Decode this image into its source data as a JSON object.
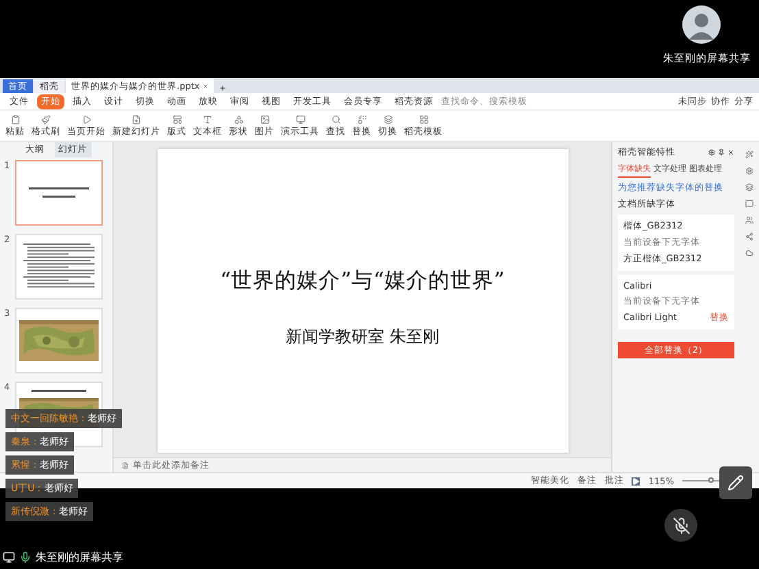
{
  "share_header": {
    "presenter": "朱至刚的屏幕共享"
  },
  "app": {
    "tabs": [
      {
        "label": "首页",
        "selected": false
      },
      {
        "label": "稻壳",
        "selected": false
      },
      {
        "label": "世界的媒介与媒介的世界.pptx",
        "selected": true
      }
    ],
    "menu": [
      {
        "label": "文件",
        "selected": false
      },
      {
        "label": "开始",
        "selected": true
      },
      {
        "label": "插入",
        "selected": false
      },
      {
        "label": "设计",
        "selected": false
      },
      {
        "label": "切换",
        "selected": false
      },
      {
        "label": "动画",
        "selected": false
      },
      {
        "label": "放映",
        "selected": false
      },
      {
        "label": "审阅",
        "selected": false
      },
      {
        "label": "视图",
        "selected": false
      },
      {
        "label": "开发工具",
        "selected": false
      },
      {
        "label": "会员专享",
        "selected": false
      },
      {
        "label": "稻壳资源",
        "selected": false
      }
    ],
    "search": {
      "placeholder": "查找命令、搜索模板"
    },
    "actions": [
      "未同步",
      "协作",
      "分享"
    ],
    "ribbon": [
      "粘贴",
      "格式刷",
      "当页开始",
      "新建幻灯片",
      "版式",
      "文本框",
      "形状",
      "图片",
      "演示工具",
      "查找",
      "替换",
      "切换",
      "稻壳模板"
    ]
  },
  "panel_tabs": [
    {
      "label": "大纲",
      "selected": false
    },
    {
      "label": "幻灯片",
      "selected": true
    }
  ],
  "slides": [
    {
      "number": "1",
      "kind": "title",
      "selected": true
    },
    {
      "number": "2",
      "kind": "text",
      "selected": false
    },
    {
      "number": "3",
      "kind": "picture",
      "selected": false
    },
    {
      "number": "4",
      "kind": "titled_picture",
      "selected": false
    }
  ],
  "slide": {
    "title": "“世界的媒介”与“媒介的世界”",
    "subtitle": "新闻学教研室 朱至刚"
  },
  "notes": {
    "placeholder": "单击此处添加备注"
  },
  "side_panel": {
    "title": "稻壳智能特性",
    "tabs": [
      {
        "label": "字体缺失",
        "selected": true
      },
      {
        "label": "文字处理",
        "selected": false
      },
      {
        "label": "图表处理",
        "selected": false
      }
    ],
    "link": "为您推荐缺失字体的替换",
    "section": "文档所缺字体",
    "fonts": [
      {
        "name": "楷体_GB2312",
        "note": "当前设备下无字体",
        "replacement": "方正楷体_GB2312"
      },
      {
        "name": "Calibri",
        "note": "当前设备下无字体",
        "replacement": "Calibri Light",
        "action": "替换"
      }
    ],
    "button": "全部替换（2）"
  },
  "status_bar": {
    "items": [
      "智能美化",
      "备注",
      "批注"
    ],
    "zoom": "115%",
    "zoom_slider": {
      "level": 0.7
    }
  },
  "chat": [
    {
      "name": "中文一回陈敏艳：",
      "message": "老师好"
    },
    {
      "name": "秦泉：",
      "message": "老师好"
    },
    {
      "name": "累惺：",
      "message": "老师好"
    },
    {
      "name": "U丁U：",
      "message": "老师好"
    },
    {
      "name": "新传倪溦：",
      "message": "老师好"
    }
  ],
  "mic": {
    "muted": true
  },
  "footer": {
    "label": "朱至刚的屏幕共享"
  }
}
